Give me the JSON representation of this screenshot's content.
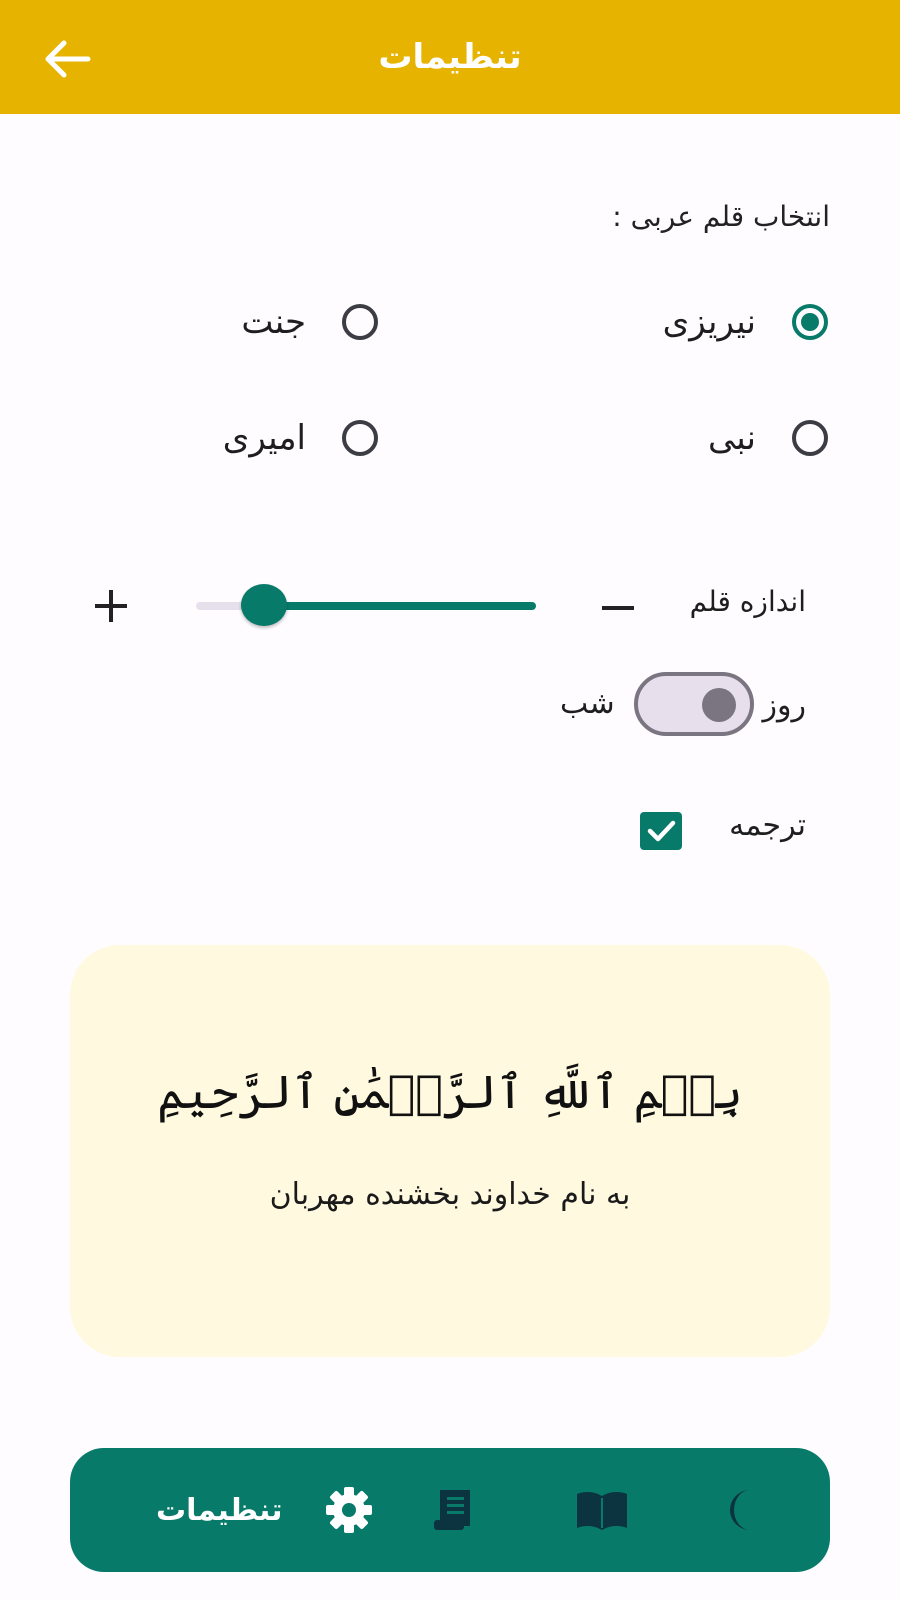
{
  "header": {
    "title": "تنظیمات"
  },
  "font_section": {
    "label": "انتخاب قلم عربی :",
    "options": [
      {
        "label": "نیریزی",
        "selected": true
      },
      {
        "label": "جنت",
        "selected": false
      },
      {
        "label": "نبی",
        "selected": false
      },
      {
        "label": "امیری",
        "selected": false
      }
    ]
  },
  "font_size": {
    "label": "اندازه قلم",
    "slider_fraction": 0.8
  },
  "theme": {
    "day_label": "روز",
    "night_label": "شب",
    "night_enabled": false
  },
  "translation": {
    "label": "ترجمه",
    "checked": true
  },
  "preview": {
    "arabic_text": "بِسۡمِ ٱللَّهِ ٱلرَّحۡمَٰنِ ٱلرَّحِيمِ",
    "translation_text": "به نام خداوند بخشنده مهربان"
  },
  "bottom_nav": {
    "settings_label": "تنظیمات"
  },
  "colors": {
    "header": "#e6b400",
    "accent": "#087a6a",
    "preview_bg": "#fff9df"
  }
}
